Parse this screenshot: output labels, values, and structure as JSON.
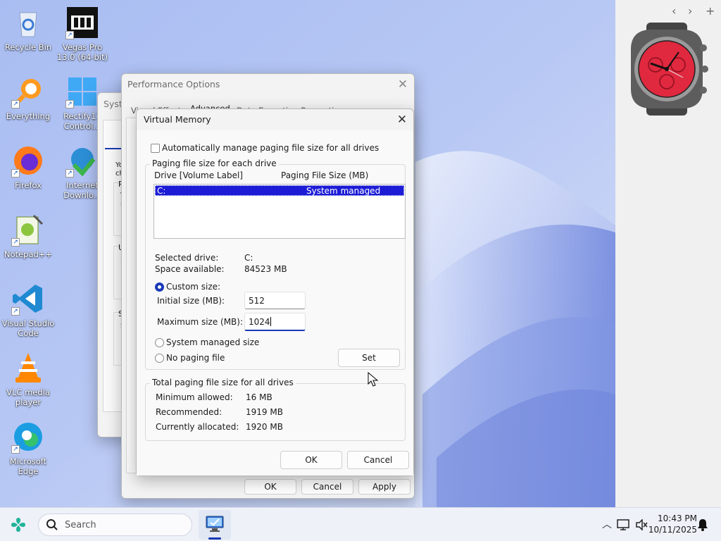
{
  "desktop_icons": [
    {
      "label": "Recycle Bin",
      "icon": "recycle-bin-icon"
    },
    {
      "label": "Vegas Pro 13.0 (64-bit)",
      "icon": "vegas-pro-icon"
    },
    {
      "label": "Everything",
      "icon": "everything-search-icon"
    },
    {
      "label": "Rectify11 Control...",
      "icon": "rectify11-icon"
    },
    {
      "label": "Firefox",
      "icon": "firefox-icon"
    },
    {
      "label": "Internet Downlo...",
      "icon": "internet-download-manager-icon"
    },
    {
      "label": "Notepad++",
      "icon": "notepad-plus-plus-icon"
    },
    {
      "label": "Visual Studio Code",
      "icon": "vscode-icon"
    },
    {
      "label": "VLC media player",
      "icon": "vlc-icon"
    },
    {
      "label": "Microsoft Edge",
      "icon": "edge-icon"
    }
  ],
  "sidebar": {
    "prev": "‹",
    "next": "›",
    "add": "+"
  },
  "system_props": {
    "title": "Syst",
    "lines": [
      "Yo",
      "ch",
      "P",
      "V",
      "n",
      "U",
      "D",
      "S",
      "S"
    ]
  },
  "perf_options": {
    "title": "Performance Options",
    "tabs": [
      "Visual Effects",
      "Advanced",
      "Data Execution Prevention"
    ],
    "ok": "OK",
    "cancel": "Cancel",
    "apply": "Apply"
  },
  "virtual_memory": {
    "title": "Virtual Memory",
    "auto_manage_label": "Automatically manage paging file size for all drives",
    "auto_manage_checked": false,
    "paging_group_label": "Paging file size for each drive",
    "col_drive": "Drive  [Volume Label]",
    "col_size": "Paging File Size (MB)",
    "drives": [
      {
        "drive": "C:",
        "size": "System managed"
      }
    ],
    "selected_drive_label": "Selected drive:",
    "selected_drive_value": "C:",
    "space_available_label": "Space available:",
    "space_available_value": "84523 MB",
    "custom_size_label": "Custom size:",
    "initial_size_label": "Initial size (MB):",
    "initial_size_value": "512",
    "max_size_label": "Maximum size (MB):",
    "max_size_value": "1024",
    "system_managed_label": "System managed size",
    "no_paging_label": "No paging file",
    "set_button": "Set",
    "total_group_label": "Total paging file size for all drives",
    "min_allowed_label": "Minimum allowed:",
    "min_allowed_value": "16 MB",
    "recommended_label": "Recommended:",
    "recommended_value": "1919 MB",
    "current_label": "Currently allocated:",
    "current_value": "1920 MB",
    "ok": "OK",
    "cancel": "Cancel"
  },
  "taskbar": {
    "search_placeholder": "Search",
    "time": "10:43 PM",
    "date": "10/11/2025"
  },
  "colors": {
    "selection": "#1c1cd6",
    "accent": "#1939b7"
  }
}
